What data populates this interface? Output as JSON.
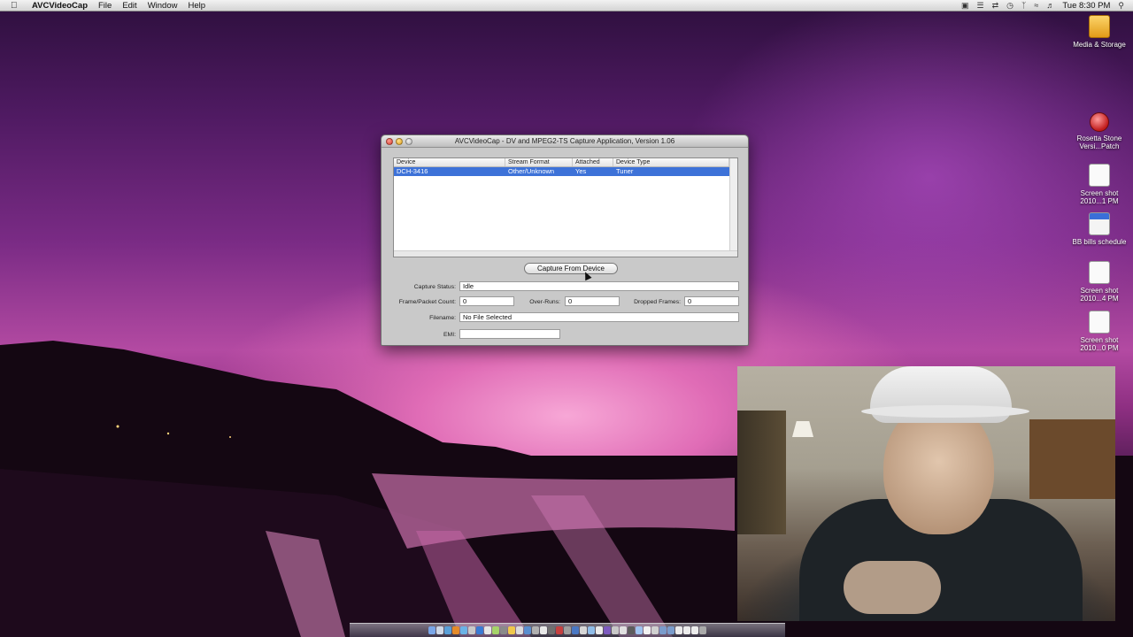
{
  "menubar": {
    "app_name": "AVCVideoCap",
    "menus": [
      "File",
      "Edit",
      "Window",
      "Help"
    ],
    "clock": "Tue 8:30 PM"
  },
  "desktop_icons": [
    {
      "label": "Media & Storage",
      "icon": "drive-icon"
    },
    {
      "label": "Rosetta Stone Versi...Patch",
      "icon": "rosetta-icon"
    },
    {
      "label": "Screen shot 2010...1 PM",
      "icon": "document-icon"
    },
    {
      "label": "BB bills schedule",
      "icon": "document-icon"
    },
    {
      "label": "Screen shot 2010...4 PM",
      "icon": "document-icon"
    },
    {
      "label": "Screen shot 2010...0 PM",
      "icon": "document-icon"
    }
  ],
  "window": {
    "title": "AVCVideoCap - DV and MPEG2-TS Capture Application, Version 1.06",
    "table": {
      "columns": [
        "Device",
        "Stream Format",
        "Attached",
        "Device Type"
      ],
      "rows": [
        [
          "DCH-3416",
          "Other/Unknown",
          "Yes",
          "Tuner"
        ]
      ]
    },
    "capture_button": "Capture From Device",
    "capture_status_label": "Capture Status:",
    "capture_status_value": "Idle",
    "frame_count_label": "Frame/Packet Count:",
    "frame_count_value": "0",
    "overruns_label": "Over-Runs:",
    "overruns_value": "0",
    "dropped_label": "Dropped Frames:",
    "dropped_value": "0",
    "filename_label": "Filename:",
    "filename_value": "No File Selected",
    "emi_label": "EMI:",
    "emi_value": ""
  },
  "colors": {
    "selection": "#3d72d8",
    "window_bg": "#c9c9c9",
    "desktop_pink": "#e06cb6"
  }
}
